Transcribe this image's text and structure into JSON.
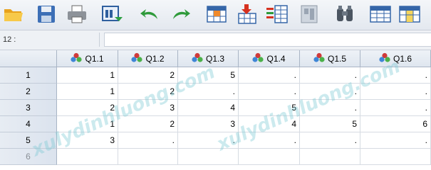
{
  "cell_reference": "12 :",
  "columns": [
    "Q1.1",
    "Q1.2",
    "Q1.3",
    "Q1.4",
    "Q1.5",
    "Q1.6"
  ],
  "rows": [
    {
      "label": "1",
      "cells": [
        "1",
        "2",
        "5",
        ".",
        ".",
        "."
      ]
    },
    {
      "label": "2",
      "cells": [
        "1",
        "2",
        ".",
        ".",
        ".",
        "."
      ]
    },
    {
      "label": "3",
      "cells": [
        "2",
        "3",
        "4",
        "5",
        ".",
        "."
      ]
    },
    {
      "label": "4",
      "cells": [
        "1",
        "2",
        "3",
        "4",
        "5",
        "6"
      ]
    },
    {
      "label": "5",
      "cells": [
        "3",
        ".",
        ".",
        ".",
        ".",
        "."
      ]
    },
    {
      "label": "6",
      "cells": [
        "",
        "",
        "",
        "",
        "",
        ""
      ]
    }
  ],
  "watermarks": [
    "xulydinhluong.com",
    "xulydinhluong.com"
  ],
  "toolbar": {
    "icons": [
      "open-folder-icon",
      "save-icon",
      "print-icon",
      "recall-dialog-icon",
      "undo-icon",
      "redo-icon",
      "go-to-case-icon",
      "go-to-variable-icon",
      "variables-icon",
      "run-descriptives-icon",
      "find-icon",
      "insert-cases-icon",
      "insert-variable-icon"
    ]
  },
  "colors": {
    "header_bg": "#dfe6ef",
    "grid_line": "#d6dbe2",
    "watermark": "#78c8d2"
  }
}
